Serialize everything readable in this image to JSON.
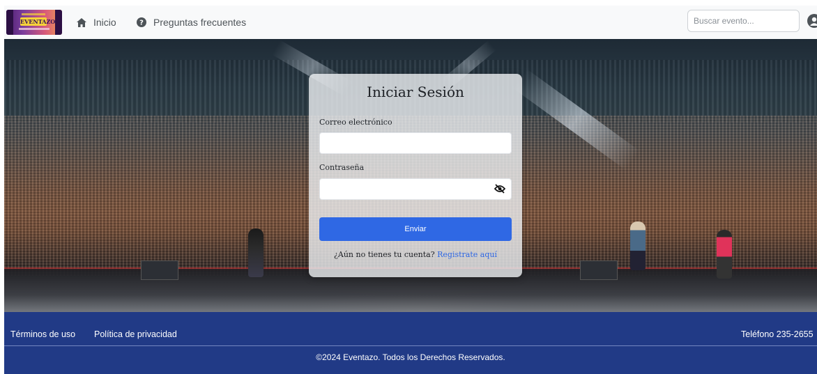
{
  "navbar": {
    "brand": {
      "logo_text": "EVENTAZO",
      "logo_icon": "ticket-logo"
    },
    "links": [
      {
        "label": "Inicio",
        "icon": "home-icon"
      },
      {
        "label": "Preguntas frecuentes",
        "icon": "question-circle-icon"
      }
    ],
    "search": {
      "placeholder": "Buscar evento...",
      "value": ""
    },
    "account_icon": "user-circle-icon"
  },
  "login": {
    "title": "Iniciar Sesión",
    "email_label": "Correo electrónico",
    "email_value": "",
    "password_label": "Contraseña",
    "password_value": "",
    "password_toggle_icon": "eye-slash-icon",
    "submit_label": "Enviar",
    "register_prompt": "¿Aún no tienes tu cuenta?",
    "register_link": "Registrate aquí"
  },
  "footer": {
    "links": [
      "Términos de uso",
      "Política de privacidad"
    ],
    "phone": "Teléfono 235-2655",
    "copyright": "©2024 Eventazo. Todos los Derechos Reservados."
  },
  "colors": {
    "primary": "#2f68e4",
    "footer_bg": "#213a86",
    "navbar_bg": "#f8f9fa"
  }
}
